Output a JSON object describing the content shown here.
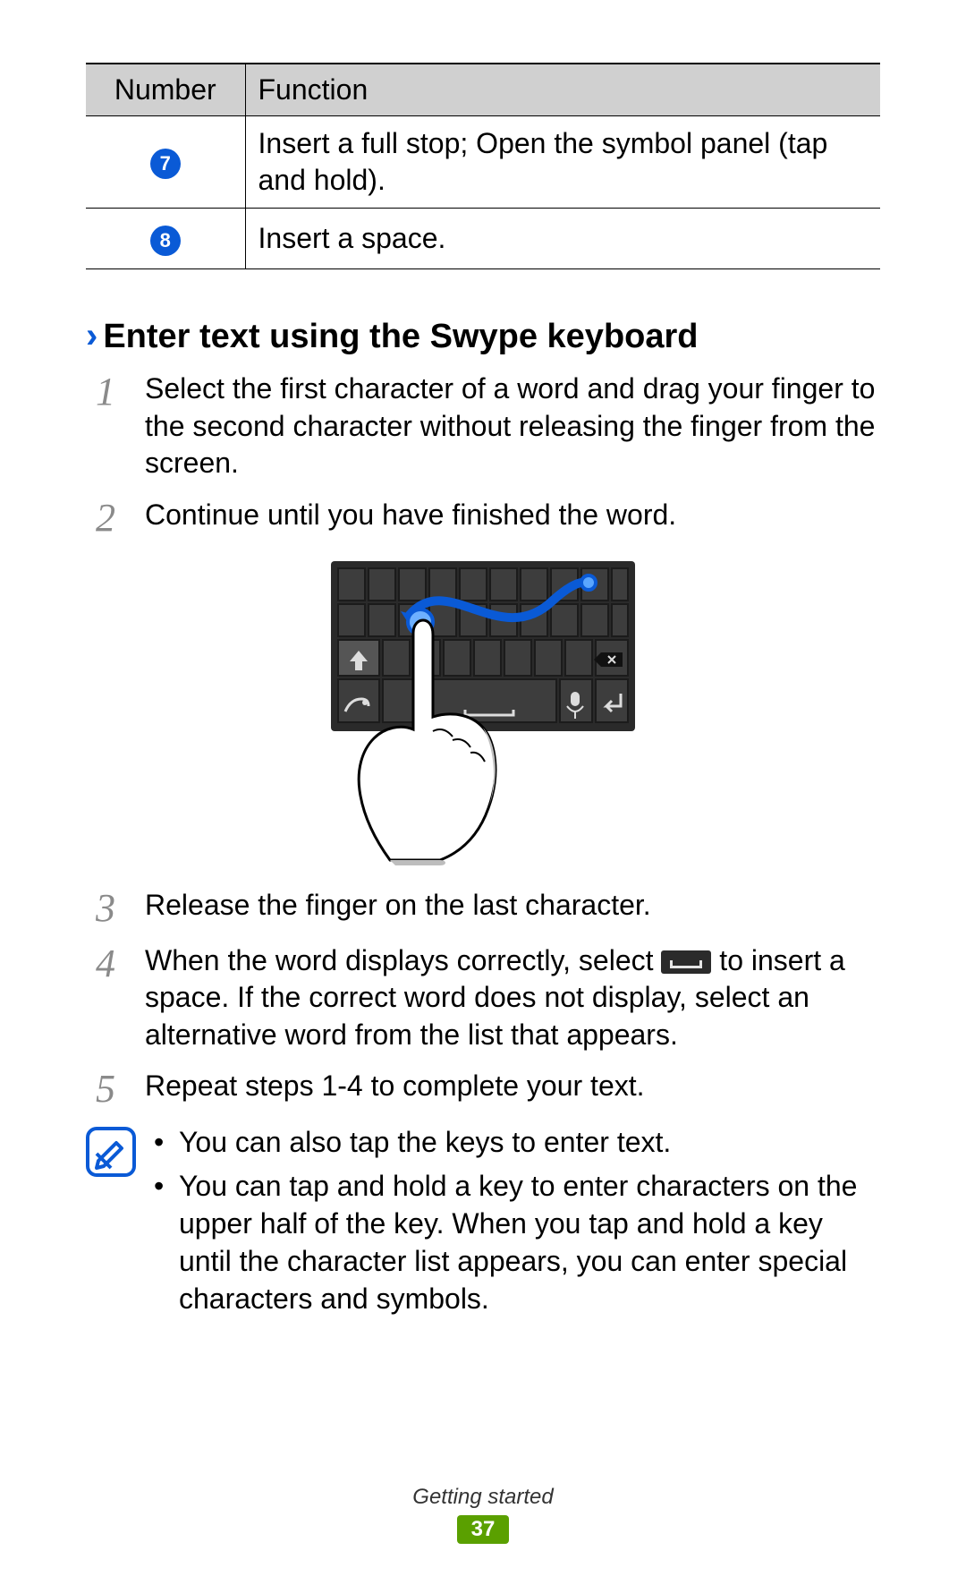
{
  "table": {
    "headers": {
      "number": "Number",
      "function": "Function"
    },
    "rows": [
      {
        "num": "7",
        "fn": "Insert a full stop; Open the symbol panel (tap and hold)."
      },
      {
        "num": "8",
        "fn": "Insert a space."
      }
    ]
  },
  "section": {
    "chevron": "›",
    "title": "Enter text using the Swype keyboard"
  },
  "steps": {
    "s1": {
      "num": "1",
      "text": "Select the first character of a word and drag your finger to the second character without releasing the finger from the screen."
    },
    "s2": {
      "num": "2",
      "text": "Continue until you have finished the word."
    },
    "s3": {
      "num": "3",
      "text": "Release the finger on the last character."
    },
    "s4": {
      "num": "4",
      "pre": "When the word displays correctly, select ",
      "post": " to insert a space. If the correct word does not display, select an alternative word from the list that appears."
    },
    "s5": {
      "num": "5",
      "text": "Repeat steps 1-4 to complete your text."
    }
  },
  "note": {
    "items": [
      "You can also tap the keys to enter text.",
      "You can tap and hold a key to enter characters on the upper half of the key. When you tap and hold a key until the character list appears, you can enter special characters and symbols."
    ]
  },
  "footer": {
    "section": "Getting started",
    "page": "37"
  }
}
